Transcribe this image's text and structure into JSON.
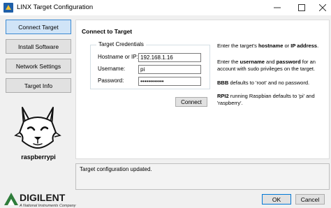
{
  "window": {
    "title": "LINX Target Configuration",
    "icons": {
      "app": "linx-app-icon",
      "minimize": "minimize-icon",
      "maximize": "maximize-icon",
      "close": "close-icon"
    }
  },
  "sidebar": {
    "items": [
      {
        "label": "Connect Target",
        "active": true
      },
      {
        "label": "Install Software",
        "active": false
      },
      {
        "label": "Network Settings",
        "active": false
      },
      {
        "label": "Target Info",
        "active": false
      }
    ],
    "mascot_icon": "wolf-mascot-icon",
    "device_name": "raspberrypi"
  },
  "main": {
    "title": "Connect to Target",
    "credentials": {
      "legend": "Target Credentials",
      "hostname_label": "Hostname or IP:",
      "hostname_value": "192.168.1.16",
      "username_label": "Username:",
      "username_value": "pi",
      "password_label": "Password:",
      "password_value": "••••••••••••"
    },
    "connect_button": "Connect",
    "help": {
      "line1_pre": "Enter the target's ",
      "line1_bold1": "hostname",
      "line1_mid": " or ",
      "line1_bold2": "IP address",
      "line1_post": ".",
      "line2_pre": "Enter the ",
      "line2_bold1": "username",
      "line2_mid": " and ",
      "line2_bold2": "password",
      "line2_post": " for an account with sudo privileges on the target.",
      "line3_bold": "BBB",
      "line3_post": " defaults to 'root' and no password.",
      "line4_bold": "RPI2",
      "line4_post": " running Raspbian defaults to 'pi' and 'raspberry'."
    }
  },
  "status": {
    "text": "Target configuration updated."
  },
  "footer": {
    "logo_text": "DIGILENT",
    "logo_tagline": "A National Instruments Company",
    "logo_icon": "digilent-logo-icon",
    "ok_label": "OK",
    "cancel_label": "Cancel"
  },
  "colors": {
    "active_nav": "#d0e4f7",
    "active_nav_border": "#3c8ad3",
    "panel_bg": "#f0f0f0",
    "brand_green": "#2f7d3b"
  }
}
